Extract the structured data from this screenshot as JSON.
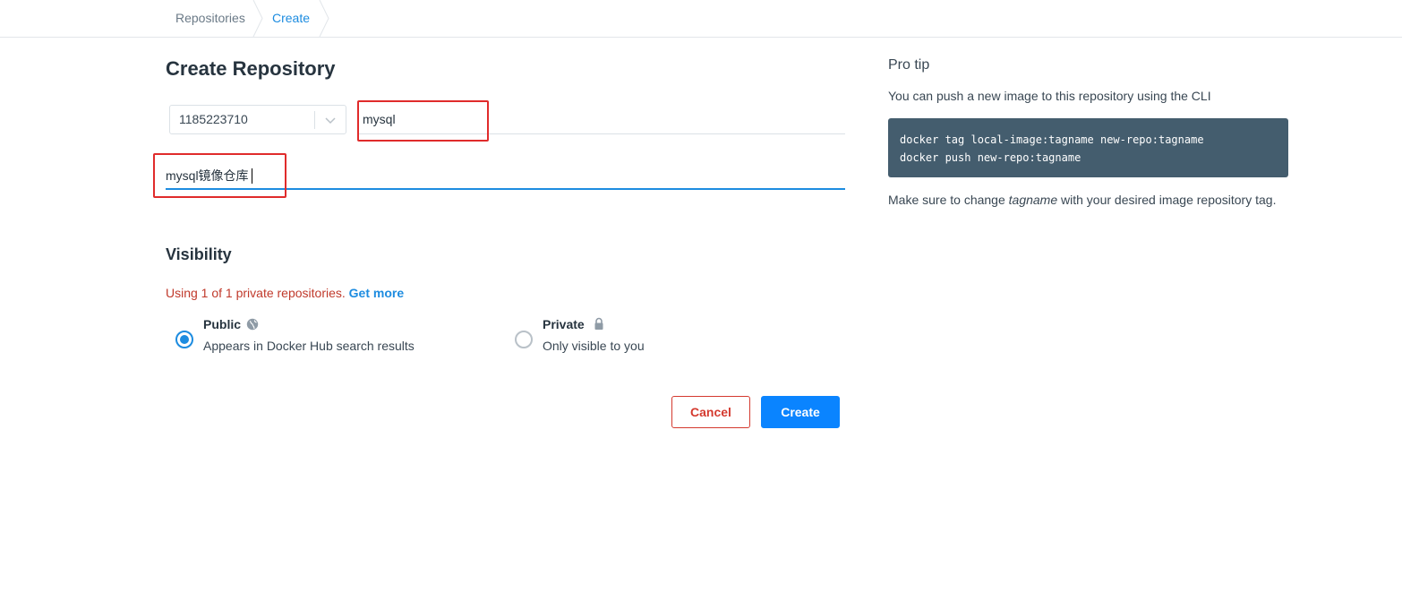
{
  "breadcrumb": {
    "items": [
      "Repositories",
      "Create"
    ]
  },
  "page": {
    "title": "Create Repository"
  },
  "form": {
    "namespace": "1185223710",
    "repo_name": "mysql",
    "description": "mysql镜像仓库"
  },
  "visibility": {
    "title": "Visibility",
    "usage_text": "Using 1 of 1 private repositories.",
    "get_more": "Get more",
    "options": [
      {
        "title": "Public",
        "description": "Appears in Docker Hub search results",
        "selected": true,
        "icon": "globe-icon"
      },
      {
        "title": "Private",
        "description": "Only visible to you",
        "selected": false,
        "icon": "lock-icon"
      }
    ]
  },
  "actions": {
    "cancel": "Cancel",
    "create": "Create"
  },
  "pro_tip": {
    "title": "Pro tip",
    "text": "You can push a new image to this repository using the CLI",
    "code": [
      "docker tag local-image:tagname new-repo:tagname",
      "docker push new-repo:tagname"
    ],
    "note_before": "Make sure to change ",
    "note_em": "tagname",
    "note_after": " with your desired image repository tag."
  },
  "colors": {
    "accent": "#1d8ce0",
    "primary_button": "#0a84ff",
    "danger": "#d43a2f",
    "code_bg": "#445d6e",
    "highlight": "#e02b2b"
  }
}
